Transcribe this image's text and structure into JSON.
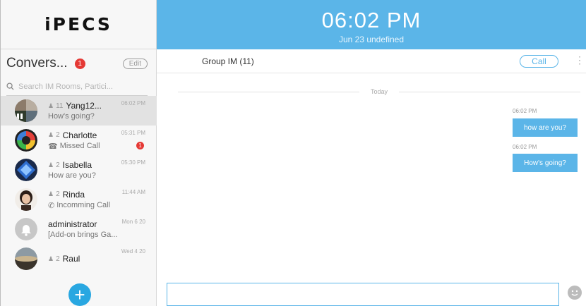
{
  "sidebar": {
    "logo_text": "iPECS",
    "header": {
      "title": "Convers...",
      "unread_badge": "1",
      "edit_label": "Edit"
    },
    "search": {
      "placeholder": "Search IM Rooms, Partici..."
    },
    "conversations": [
      {
        "count": "11",
        "name": "Yang12...",
        "time": "06:02 PM",
        "preview": "How's going?",
        "active": true
      },
      {
        "count": "2",
        "name": "Charlotte",
        "time": "05:31 PM",
        "preview": "Missed Call",
        "preview_icon": "missed-call-icon",
        "unread": "1"
      },
      {
        "count": "2",
        "name": "Isabella",
        "time": "05:30 PM",
        "preview": "How are you?"
      },
      {
        "count": "2",
        "name": "Rinda",
        "time": "11:44 AM",
        "preview": "Incomming Call",
        "preview_icon": "incoming-call-icon"
      },
      {
        "count": "",
        "name": "administrator",
        "time": "Mon 6 20",
        "preview": "[Add-on brings Ga..."
      },
      {
        "count": "2",
        "name": "Raul",
        "time": "Wed 4 20",
        "preview": ""
      }
    ],
    "add_button_icon": "plus-icon"
  },
  "top_bar": {
    "time": "06:02 PM",
    "date": "Jun 23 undefined"
  },
  "chat": {
    "title": "Group IM (11)",
    "call_label": "Call",
    "more_icon": "vertical-dots-icon",
    "divider_label": "Today",
    "messages": [
      {
        "time": "06:02 PM",
        "text": "how are you?"
      },
      {
        "time": "06:02 PM",
        "text": "How's going?"
      }
    ],
    "compose_placeholder": "",
    "emoji_icon": "smiley-icon"
  },
  "colors": {
    "accent": "#5bb5e8",
    "add_button": "#29a7e1",
    "badge": "#e53935"
  }
}
